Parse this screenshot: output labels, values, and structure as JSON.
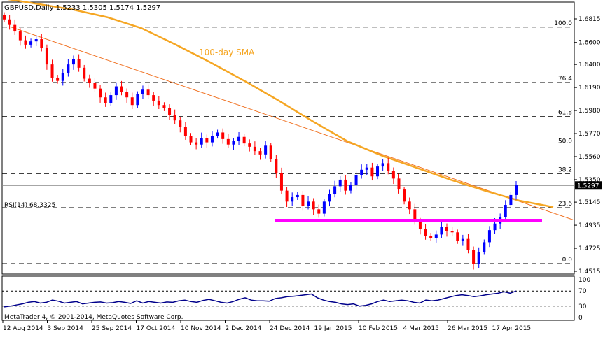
{
  "chart_data": {
    "type": "candlestick",
    "symbol_header": "GBPUSD,Daily  1.5233 1.5305 1.5174 1.5297",
    "last_price_label": "1.5297",
    "last_price": 1.5297,
    "sma_label": "100-day SMA",
    "price_ticks": [
      "1.6815",
      "1.6600",
      "1.6400",
      "1.6190",
      "1.5980",
      "1.5770",
      "1.5560",
      "1.5350",
      "1.5145",
      "1.4935",
      "1.4725",
      "1.4515"
    ],
    "fib_levels": [
      {
        "label": "100.0",
        "price": 1.674
      },
      {
        "label": "76.4",
        "price": 1.6235
      },
      {
        "label": "61.8",
        "price": 1.5925
      },
      {
        "label": "50.0",
        "price": 1.5665
      },
      {
        "label": "38.2",
        "price": 1.5405
      },
      {
        "label": "23.6",
        "price": 1.5095
      },
      {
        "label": "0.0",
        "price": 1.4585
      }
    ],
    "support_level": 1.498,
    "trendline": {
      "from_date": "12 Aug 2014",
      "from_price": 1.674,
      "to_date": "28 Apr 2015",
      "to_price": 1.4985
    },
    "x_labels": [
      "12 Aug 2014",
      "3 Sep 2014",
      "25 Sep 2014",
      "17 Oct 2014",
      "10 Nov 2014",
      "2 Dec 2014",
      "24 Dec 2014",
      "19 Jan 2015",
      "10 Feb 2015",
      "4 Mar 2015",
      "26 Mar 2015",
      "17 Apr 2015"
    ],
    "close_path": [
      1.681,
      1.676,
      1.67,
      1.662,
      1.658,
      1.661,
      1.663,
      1.655,
      1.64,
      1.628,
      1.625,
      1.632,
      1.64,
      1.645,
      1.637,
      1.627,
      1.623,
      1.618,
      1.61,
      1.605,
      1.612,
      1.62,
      1.615,
      1.61,
      1.603,
      1.613,
      1.617,
      1.612,
      1.607,
      1.603,
      1.6,
      1.594,
      1.589,
      1.583,
      1.575,
      1.569,
      1.567,
      1.573,
      1.569,
      1.575,
      1.578,
      1.572,
      1.567,
      1.57,
      1.574,
      1.568,
      1.565,
      1.561,
      1.558,
      1.566,
      1.554,
      1.541,
      1.525,
      1.515,
      1.519,
      1.521,
      1.511,
      1.515,
      1.508,
      1.504,
      1.515,
      1.522,
      1.529,
      1.535,
      1.525,
      1.53,
      1.539,
      1.544,
      1.546,
      1.538,
      1.547,
      1.55,
      1.543,
      1.536,
      1.526,
      1.515,
      1.508,
      1.497,
      1.49,
      1.484,
      1.482,
      1.485,
      1.492,
      1.488,
      1.487,
      1.479,
      1.481,
      1.471,
      1.458,
      1.469,
      1.478,
      1.489,
      1.495,
      1.501,
      1.512,
      1.521,
      1.53
    ],
    "sma_path": [
      1.7,
      1.695,
      1.69,
      1.683,
      1.673,
      1.658,
      1.642,
      1.625,
      1.607,
      1.588,
      1.57,
      1.557,
      1.546,
      1.535,
      1.525,
      1.516,
      1.51
    ],
    "rsi_label": "RSI(14) 68.3325",
    "rsi_value": 68.3325,
    "rsi_ticks": [
      "100",
      "70",
      "30",
      "0"
    ],
    "rsi_levels": [
      70,
      30
    ],
    "rsi_path": [
      28,
      30,
      33,
      36,
      40,
      42,
      38,
      40,
      46,
      43,
      38,
      40,
      42,
      36,
      38,
      40,
      41,
      38,
      39,
      42,
      40,
      37,
      44,
      38,
      42,
      40,
      38,
      41,
      40,
      44,
      46,
      42,
      40,
      45,
      48,
      44,
      40,
      38,
      42,
      48,
      52,
      46,
      44,
      44,
      43,
      50,
      52,
      55,
      56,
      58,
      60,
      62,
      52,
      46,
      42,
      40,
      36,
      34,
      36,
      30,
      32,
      36,
      42,
      46,
      42,
      44,
      46,
      44,
      40,
      38,
      46,
      44,
      46,
      50,
      54,
      58,
      60,
      58,
      55,
      57,
      60,
      62,
      64,
      68,
      64,
      70
    ],
    "copyright": "MetaTrader 4, © 2001-2014, MetaQuotes Software Corp.",
    "colors": {
      "bull": "#0000ff",
      "bear": "#ff0000",
      "sma": "#f5a623",
      "trendline": "#f07020",
      "support": "#ff00ff",
      "rsi": "#00008b",
      "grid": "#000000",
      "last_price_box": "#000000"
    }
  }
}
